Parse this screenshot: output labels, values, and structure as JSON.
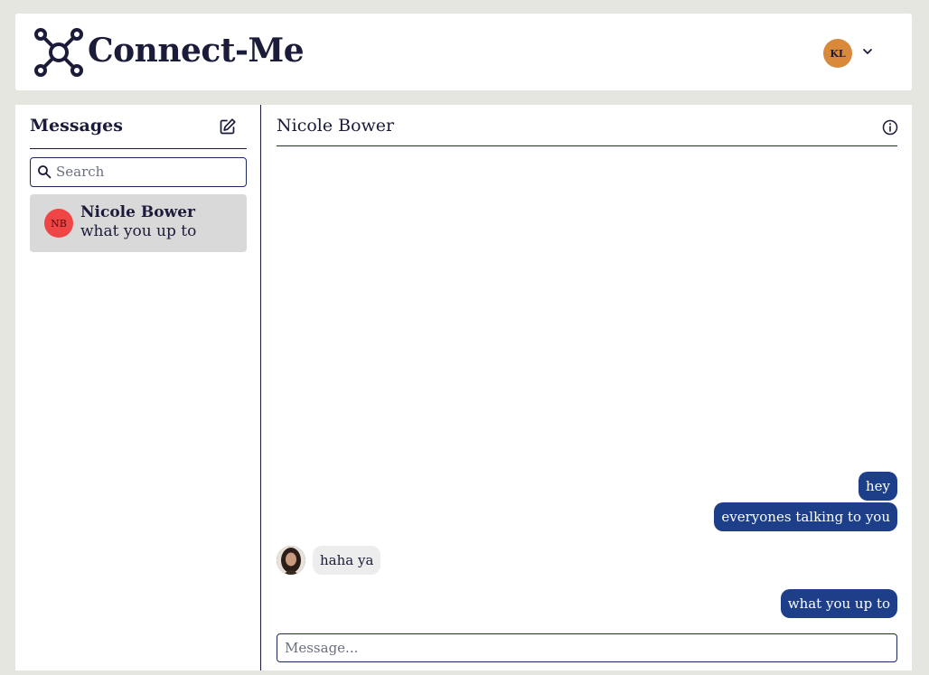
{
  "header": {
    "brand": "Connect-Me",
    "logo_icon": "hub-network-icon",
    "user_initials": "KL",
    "user_avatar_color": "#d88a3a",
    "chevron_icon": "chevron-down-icon"
  },
  "sidebar": {
    "title": "Messages",
    "compose_icon": "edit-square-icon",
    "search": {
      "placeholder": "Search",
      "value": ""
    },
    "conversations": [
      {
        "initials": "NB",
        "name": "Nicole Bower",
        "preview": "what you up to",
        "avatar_color": "#f04545",
        "selected": true
      }
    ]
  },
  "chat": {
    "title": "Nicole Bower",
    "info_icon": "info-circle-icon",
    "messages": [
      {
        "direction": "outgoing",
        "text": "hey"
      },
      {
        "direction": "outgoing",
        "text": "everyones talking to you"
      },
      {
        "direction": "incoming",
        "text": "haha ya"
      },
      {
        "direction": "outgoing",
        "text": "what you up to"
      }
    ],
    "composer": {
      "placeholder": "Message...",
      "value": ""
    }
  },
  "colors": {
    "background": "#e6e6e1",
    "navy": "#1b1b3a",
    "outgoing_bubble": "#1d3f8a",
    "incoming_bubble": "#ededed",
    "selected_conversation": "#d9d9d9"
  }
}
